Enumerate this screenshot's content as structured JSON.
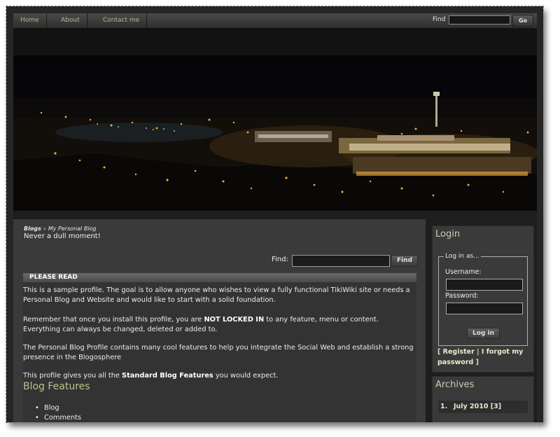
{
  "nav": {
    "items": [
      {
        "label": "Home"
      },
      {
        "label": "About"
      },
      {
        "label": "Contact me"
      }
    ],
    "find_label": "Find",
    "go_label": "Go"
  },
  "main": {
    "breadcrumb": {
      "root": "Blogs",
      "sep": "»",
      "current": "My Personal Blog"
    },
    "tagline": "Never a dull moment!",
    "find_label": "Find:",
    "find_button": "Find",
    "please_read": {
      "heading": "PLEASE READ",
      "p1": "This is a sample profile. The goal is to allow anyone who wishes to view a fully functional TikiWiki site or needs a Personal Blog and Website and would like to start with a solid foundation.",
      "p2_pre": "Remember that once you install this profile, you are ",
      "p2_bold": "NOT LOCKED IN",
      "p2_post": " to any feature, menu or content. Everything can always be changed, deleted or added to.",
      "p3": "The Personal Blog Profile contains many cool features to help you integrate the Social Web and establish a strong presence in the Blogosphere",
      "p4_pre": "This profile gives you all the ",
      "p4_bold": "Standard Blog Features",
      "p4_post": " you would expect.",
      "features_title": "Blog Features",
      "features": [
        "Blog",
        "Comments"
      ]
    }
  },
  "sidebar": {
    "login": {
      "title": "Login",
      "legend": "Log in as...",
      "username_label": "Username:",
      "password_label": "Password:",
      "button": "Log in",
      "open_bracket": "[",
      "register": "Register",
      "pipe": "|",
      "forgot": "I forgot my password",
      "close_bracket": "]"
    },
    "archives": {
      "title": "Archives",
      "items": [
        {
          "num": "1.",
          "label": "July 2010 [3]"
        }
      ]
    }
  }
}
